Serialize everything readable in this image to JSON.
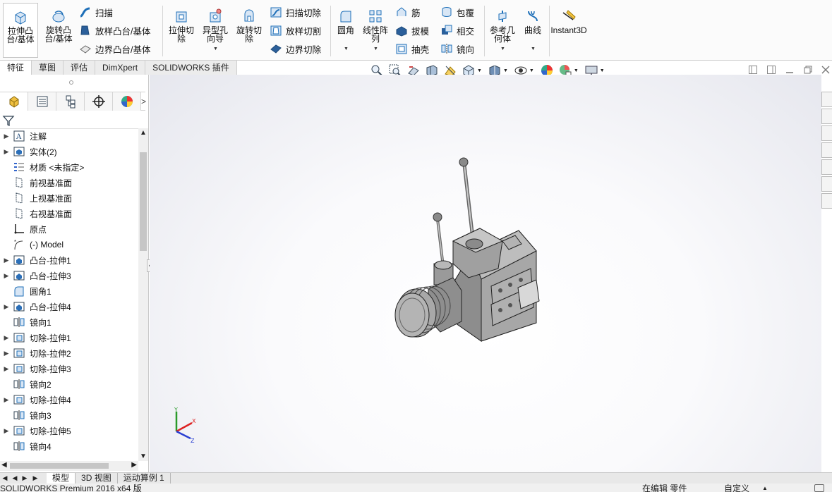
{
  "ribbon": {
    "extrude_boss": "拉伸凸\n台/基体",
    "revolve_boss": "旋转凸\n台/基体",
    "sweep": "扫描",
    "loft_boss": "放样凸台/基体",
    "boundary_boss": "边界凸台/基体",
    "extrude_cut": "拉伸切\n除",
    "hole_wizard": "异型孔\n向导",
    "revolve_cut": "旋转切\n除",
    "swept_cut": "扫描切除",
    "lofted_cut": "放样切割",
    "boundary_cut": "边界切除",
    "fillet": "圆角",
    "linear_pattern": "线性阵\n列",
    "rib": "筋",
    "draft": "拔模",
    "shell": "抽壳",
    "wrap": "包覆",
    "intersect": "相交",
    "mirror": "镜向",
    "ref_geometry": "参考几\n何体",
    "curves": "曲线",
    "instant3d": "Instant3D"
  },
  "tabs": [
    "特征",
    "草图",
    "评估",
    "DimXpert",
    "SOLIDWORKS 插件"
  ],
  "tree": [
    {
      "label": "注解",
      "icon": "annotation-icon",
      "expand": true
    },
    {
      "label": "实体(2)",
      "icon": "solid-bodies-icon",
      "expand": true
    },
    {
      "label": "材质 <未指定>",
      "icon": "material-icon",
      "expand": false
    },
    {
      "label": "前视基准面",
      "icon": "plane-icon",
      "expand": false
    },
    {
      "label": "上视基准面",
      "icon": "plane-icon",
      "expand": false
    },
    {
      "label": "右视基准面",
      "icon": "plane-icon",
      "expand": false
    },
    {
      "label": "原点",
      "icon": "origin-icon",
      "expand": false
    },
    {
      "label": "(-) Model",
      "icon": "sketch-icon",
      "expand": false
    },
    {
      "label": "凸台-拉伸1",
      "icon": "boss-extrude-icon",
      "expand": true
    },
    {
      "label": "凸台-拉伸3",
      "icon": "boss-extrude-icon",
      "expand": true
    },
    {
      "label": "圆角1",
      "icon": "fillet-icon",
      "expand": false
    },
    {
      "label": "凸台-拉伸4",
      "icon": "boss-extrude-icon",
      "expand": true
    },
    {
      "label": "镜向1",
      "icon": "mirror-icon",
      "expand": false
    },
    {
      "label": "切除-拉伸1",
      "icon": "cut-extrude-icon",
      "expand": true
    },
    {
      "label": "切除-拉伸2",
      "icon": "cut-extrude-icon",
      "expand": true
    },
    {
      "label": "切除-拉伸3",
      "icon": "cut-extrude-icon",
      "expand": true
    },
    {
      "label": "镜向2",
      "icon": "mirror-icon",
      "expand": false
    },
    {
      "label": "切除-拉伸4",
      "icon": "cut-extrude-icon",
      "expand": true
    },
    {
      "label": "镜向3",
      "icon": "mirror-icon",
      "expand": false
    },
    {
      "label": "切除-拉伸5",
      "icon": "cut-extrude-icon",
      "expand": true
    },
    {
      "label": "镜向4",
      "icon": "mirror-icon",
      "expand": false
    }
  ],
  "bottom_tabs": [
    "模型",
    "3D 视图",
    "运动算例 1"
  ],
  "status": {
    "app": "SOLIDWORKS Premium 2016 x64 版",
    "mode": "在编辑 零件",
    "custom": "自定义"
  },
  "colors": {
    "accent": "#1e6fb8",
    "part_gray": "#a8a8a8"
  }
}
